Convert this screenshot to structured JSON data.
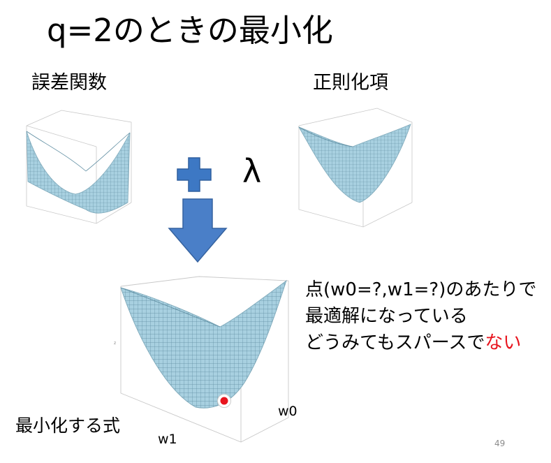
{
  "slide": {
    "title": "q=2のときの最小化",
    "error_label": "誤差関数",
    "regularizer_label": "正則化項",
    "lambda": "λ",
    "description": {
      "line1": "点(w0=?,w1=?)のあたりで",
      "line2": "最適解になっている",
      "line3_normal": "どうみてもスパースで",
      "line3_highlight": "ない"
    },
    "objective_label": "最小化する式",
    "axis_w0": "w0",
    "axis_w1": "w1",
    "page_number": "49"
  },
  "colors": {
    "plus": "#3d78c4",
    "arrow": "#4a7fc8",
    "surface": "#a8d0e0",
    "highlight": "#e8141e"
  },
  "icons": {
    "operator": "plus-icon",
    "flow": "down-arrow-icon",
    "minimum": "minimum-point-icon"
  }
}
